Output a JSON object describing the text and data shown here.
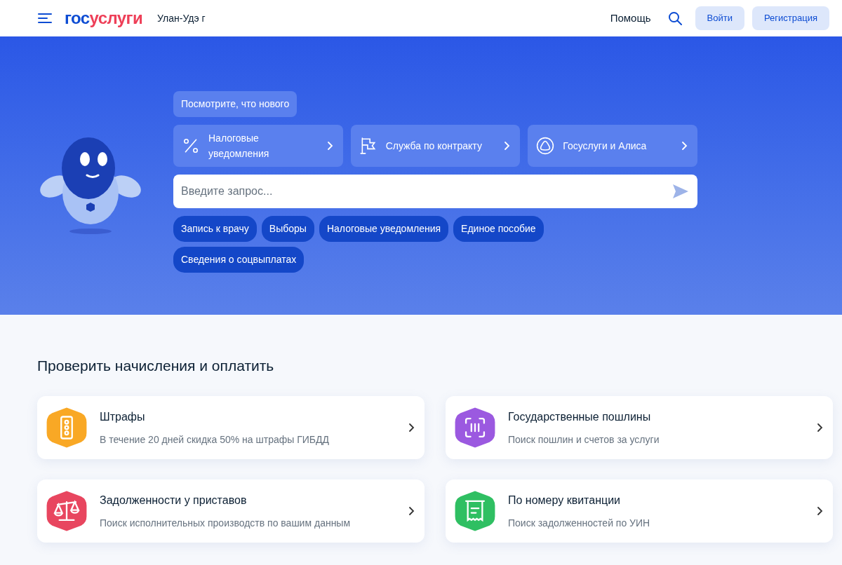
{
  "header": {
    "logo": {
      "first": "гос",
      "second": "услуги"
    },
    "city": "Улан-Удэ г",
    "help": "Помощь",
    "login": "Войти",
    "register": "Регистрация"
  },
  "hero": {
    "news": "Посмотрите, что нового",
    "promos": [
      {
        "kind": "percent",
        "label": "Налоговые уведомления"
      },
      {
        "kind": "flag",
        "label": "Служба по контракту"
      },
      {
        "kind": "ring",
        "label": "Госуслуги и Алиса"
      }
    ],
    "search": {
      "placeholder": "Введите запрос..."
    },
    "chips": [
      "Запись к врачу",
      "Выборы",
      "Налоговые уведомления",
      "Единое пособие",
      "Сведения о соцвыплатах"
    ]
  },
  "section": {
    "title": "Проверить начисления и оплатить",
    "cards": [
      {
        "kind": "traffic-light",
        "color": "#f9a825",
        "title": "Штрафы",
        "subtitle": "В течение 20 дней скидка 50% на штрафы ГИБДД"
      },
      {
        "kind": "barcode",
        "color": "#9b59e0",
        "title": "Государственные пошлины",
        "subtitle": "Поиск пошлин и счетов за услуги"
      },
      {
        "kind": "scales",
        "color": "#e8465f",
        "title": "Задолженности у приставов",
        "subtitle": "Поиск исполнительных производств по вашим данным"
      },
      {
        "kind": "receipt",
        "color": "#2fbf62",
        "title": "По номеру квитанции",
        "subtitle": "Поиск задолженностей по УИН"
      }
    ]
  }
}
